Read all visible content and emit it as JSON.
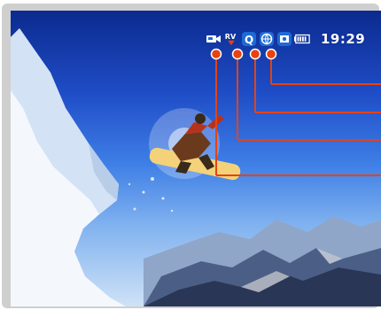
{
  "status_bar": {
    "time": "19:29",
    "icons": [
      "video-camera-icon",
      "rv-icon",
      "q-icon",
      "globe-icon",
      "photo-icon",
      "battery-icon"
    ],
    "rv_text": "RV",
    "q_text": "Q"
  },
  "colors": {
    "callout": "#e8420e",
    "icon_badge": "#1e6ad6",
    "frame": "#cfcfcf"
  },
  "callouts": {
    "count": 4,
    "targets": [
      "globe-icon",
      "q-icon",
      "rv-icon",
      "video-camera-icon"
    ]
  }
}
